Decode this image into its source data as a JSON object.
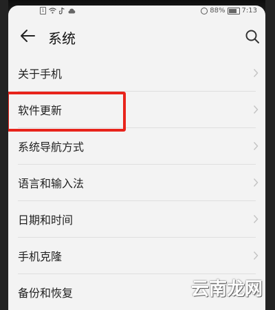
{
  "status_bar": {
    "battery_percent": "88%",
    "time": "7:13",
    "sim_label": "1"
  },
  "header": {
    "title": "系统"
  },
  "menu": {
    "items": [
      {
        "label": "关于手机"
      },
      {
        "label": "软件更新"
      },
      {
        "label": "系统导航方式"
      },
      {
        "label": "语言和输入法"
      },
      {
        "label": "日期和时间"
      },
      {
        "label": "手机克隆"
      },
      {
        "label": "备份和恢复"
      }
    ]
  },
  "watermark": {
    "text": "云南龙网"
  },
  "colors": {
    "highlight": "#e8231b",
    "background": "#f3f3f3"
  }
}
